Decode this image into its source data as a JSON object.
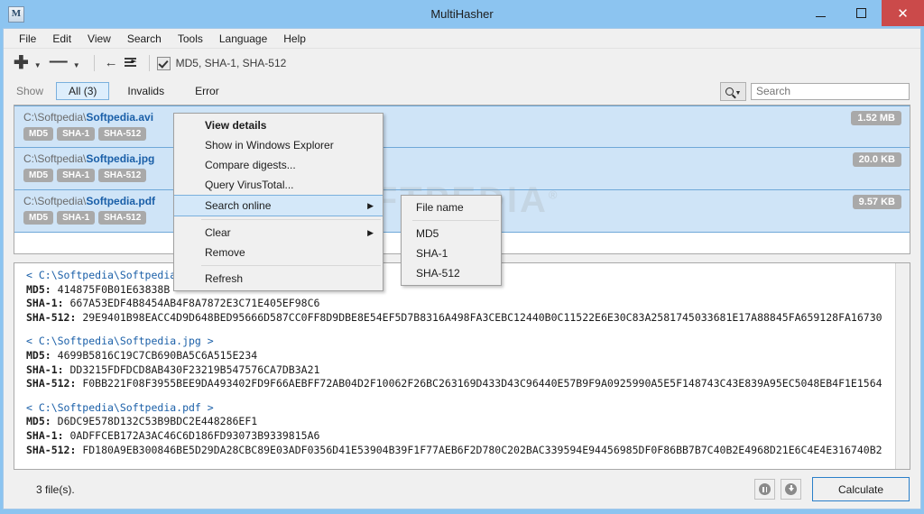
{
  "window": {
    "title": "MultiHasher",
    "app_icon": "M",
    "minimize": "–",
    "maximize": "□",
    "close": "✕"
  },
  "menubar": {
    "items": [
      {
        "label": "File"
      },
      {
        "label": "Edit"
      },
      {
        "label": "View"
      },
      {
        "label": "Search"
      },
      {
        "label": "Tools"
      },
      {
        "label": "Language"
      },
      {
        "label": "Help"
      }
    ]
  },
  "toolbar": {
    "add_icon": "✚",
    "add_caret": "▼",
    "remove_icon": "—",
    "remove_caret": "▼",
    "undo_icon": "←",
    "list_icon": "list-select-icon",
    "algorithms_label": "MD5, SHA-1, SHA-512",
    "algorithms_checked": true
  },
  "filterbar": {
    "show_label": "Show",
    "tabs": [
      {
        "label": "All (3)",
        "active": true
      },
      {
        "label": "Invalids",
        "active": false
      },
      {
        "label": "Error",
        "active": false
      }
    ],
    "search_button_caret": "▼",
    "search_placeholder": "Search",
    "search_value": ""
  },
  "filelist": {
    "rows": [
      {
        "dir": "C:\\Softpedia\\",
        "name": "Softpedia.avi",
        "badges": [
          "MD5",
          "SHA-1",
          "SHA-512"
        ],
        "size": "1.52 MB"
      },
      {
        "dir": "C:\\Softpedia\\",
        "name": "Softpedia.jpg",
        "badges": [
          "MD5",
          "SHA-1",
          "SHA-512"
        ],
        "size": "20.0 KB"
      },
      {
        "dir": "C:\\Softpedia\\",
        "name": "Softpedia.pdf",
        "badges": [
          "MD5",
          "SHA-1",
          "SHA-512"
        ],
        "size": "9.57 KB"
      }
    ]
  },
  "results": {
    "blocks": [
      {
        "header": "< C:\\Softpedia\\Softpedia.avi >",
        "md5_key": "MD5:",
        "md5_value": "414875F0B01E63838B",
        "sha1_key": "SHA-1:",
        "sha1_value": "667A53EDF4B8454AB4F8A7872E3C71E405EF98C6",
        "sha512_key": "SHA-512:",
        "sha512_value": "29E9401B98EACC4D9D648BED95666D587CC0FF8D9DBE8E54EF5D7B8316A498FA3CEBC12440B0C11522E6E30C83A2581745033681E17A88845FA659128FA16730"
      },
      {
        "header": "< C:\\Softpedia\\Softpedia.jpg >",
        "md5_key": "MD5:",
        "md5_value": "4699B5816C19C7CB690BA5C6A515E234",
        "sha1_key": "SHA-1:",
        "sha1_value": "DD3215FDFDCD8AB430F23219B547576CA7DB3A21",
        "sha512_key": "SHA-512:",
        "sha512_value": "F0BB221F08F3955BEE9DA493402FD9F66AEBFF72AB04D2F10062F26BC263169D433D43C96440E57B9F9A0925990A5E5F148743C43E839A95EC5048EB4F1E1564"
      },
      {
        "header": "< C:\\Softpedia\\Softpedia.pdf >",
        "md5_key": "MD5:",
        "md5_value": "D6DC9E578D132C53B9BDC2E448286EF1",
        "sha1_key": "SHA-1:",
        "sha1_value": "0ADFFCEB172A3AC46C6D186FD93073B9339815A6",
        "sha512_key": "SHA-512:",
        "sha512_value": "FD180A9EB300846BE5D29DA28CBC89E03ADF0356D41E53904B39F1F77AEB6F2D780C202BAC339594E94456985DF0F86BB7B7C40B2E4968D21E6C4E4E316740B2"
      }
    ]
  },
  "statusbar": {
    "file_count": "3 file(s).",
    "pause_icon": "pause-icon",
    "stop_icon": "download-icon",
    "calculate_label": "Calculate"
  },
  "context_menu": {
    "items": [
      {
        "label": "View details",
        "bold": true,
        "submenu": false,
        "sep_after": false
      },
      {
        "label": "Show in Windows Explorer",
        "bold": false,
        "submenu": false,
        "sep_after": false
      },
      {
        "label": "Compare digests...",
        "bold": false,
        "submenu": false,
        "sep_after": false
      },
      {
        "label": "Query VirusTotal...",
        "bold": false,
        "submenu": false,
        "sep_after": false
      },
      {
        "label": "Search online",
        "bold": false,
        "submenu": true,
        "highlight": true,
        "sep_after": true
      },
      {
        "label": "Clear",
        "bold": false,
        "submenu": true,
        "sep_after": false
      },
      {
        "label": "Remove",
        "bold": false,
        "submenu": false,
        "sep_after": true
      },
      {
        "label": "Refresh",
        "bold": false,
        "submenu": false,
        "sep_after": false
      }
    ],
    "submenu_arrow": "▶"
  },
  "submenu": {
    "items": [
      {
        "label": "File name",
        "sep_after": true
      },
      {
        "label": "MD5",
        "sep_after": false
      },
      {
        "label": "SHA-1",
        "sep_after": false
      },
      {
        "label": "SHA-512",
        "sep_after": false
      }
    ]
  },
  "watermark": {
    "text": "SOFTPEDIA",
    "mark": "®"
  },
  "colors": {
    "title_bar": "#8cc4f0",
    "close_button": "#cb4a4a",
    "selection": "#cfe4f7",
    "link_blue": "#1a5fa8",
    "badge_gray": "#a9a9a9"
  }
}
